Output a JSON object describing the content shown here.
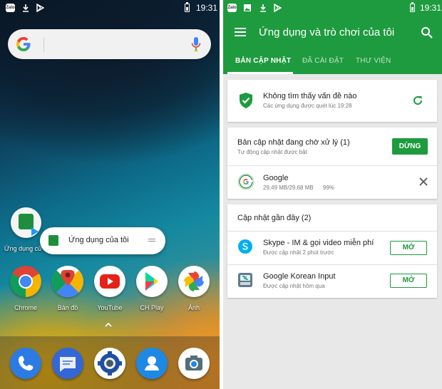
{
  "left_phone": {
    "status": {
      "time": "19:31",
      "zalo": "Zalo"
    },
    "popup": {
      "app_label": "Ứng dụng củ",
      "shortcut_label": "Ứng dụng của tôi"
    },
    "apps": [
      {
        "name": "Chrome"
      },
      {
        "name": "Bản đồ"
      },
      {
        "name": "YouTube"
      },
      {
        "name": "CH Play"
      },
      {
        "name": "Ảnh"
      }
    ],
    "dock": [
      "phone",
      "messages",
      "settings",
      "contacts",
      "camera"
    ]
  },
  "right_phone": {
    "status": {
      "time": "19:31",
      "zalo": "Zalo"
    },
    "header": {
      "title": "Ứng dụng và trò chơi của tôi"
    },
    "tabs": [
      {
        "label": "BẢN CẬP NHẬT",
        "active": true
      },
      {
        "label": "ĐÃ CÀI ĐẶT",
        "active": false
      },
      {
        "label": "THƯ VIỆN",
        "active": false
      }
    ],
    "protect": {
      "title": "Không tìm thấy vấn đề nào",
      "subtitle": "Các ứng dụng được quét lúc 19:28"
    },
    "pending": {
      "title": "Bản cập nhật đang chờ xử lý (1)",
      "subtitle": "Tự động cập nhật được bật",
      "button": "DỪNG",
      "item": {
        "name": "Google",
        "progress_text": "29,49 MB/29,68 MB",
        "percent": "99%"
      }
    },
    "recent": {
      "title": "Cập nhật gần đây (2)",
      "items": [
        {
          "name": "Skype - IM & gọi video miễn phí",
          "subtitle": "Được cập nhật 2 phút trước",
          "button": "MỞ"
        },
        {
          "name": "Google Korean Input",
          "subtitle": "Được cập nhật hôm qua",
          "button": "MỞ"
        }
      ]
    },
    "colors": {
      "accent": "#1e9b3e"
    }
  }
}
